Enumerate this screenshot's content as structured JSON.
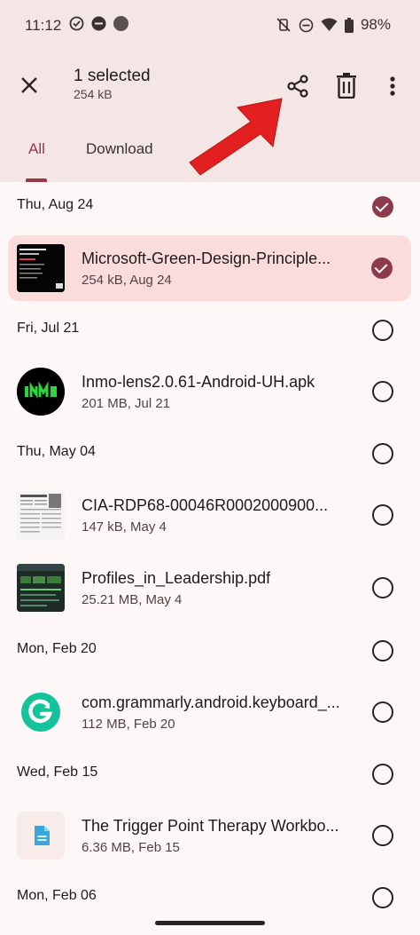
{
  "status": {
    "time": "11:12",
    "battery": "98%"
  },
  "appbar": {
    "title": "1 selected",
    "subtitle": "254 kB"
  },
  "tabs": [
    "All",
    "Download"
  ],
  "groups": [
    {
      "date": "Thu, Aug 24",
      "checked": true
    },
    {
      "date": "Fri, Jul 21",
      "checked": false
    },
    {
      "date": "Thu, May 04",
      "checked": false
    },
    {
      "date": "Mon, Feb 20",
      "checked": false
    },
    {
      "date": "Wed, Feb 15",
      "checked": false
    },
    {
      "date": "Mon, Feb 06",
      "checked": false
    }
  ],
  "files": [
    {
      "name": "Microsoft-Green-Design-Principle...",
      "meta": "254 kB, Aug 24",
      "selected": true,
      "icon": "document-thumbnail"
    },
    {
      "name": "Inmo-lens2.0.61-Android-UH.apk",
      "meta": "201 MB, Jul 21",
      "selected": false,
      "icon": "inmo-app-icon"
    },
    {
      "name": "CIA-RDP68-00046R0002000900...",
      "meta": "147 kB, May 4",
      "selected": false,
      "icon": "newspaper-thumbnail"
    },
    {
      "name": "Profiles_in_Leadership.pdf",
      "meta": "25.21 MB, May 4",
      "selected": false,
      "icon": "pdf-thumbnail"
    },
    {
      "name": "com.grammarly.android.keyboard_...",
      "meta": "112 MB, Feb 20",
      "selected": false,
      "icon": "grammarly-icon"
    },
    {
      "name": "The Trigger Point Therapy Workbo...",
      "meta": "6.36 MB, Feb 15",
      "selected": false,
      "icon": "file-icon"
    }
  ],
  "colors": {
    "accent": "#9a3648",
    "selected_row": "#fbdcdc",
    "header_bg": "#f3e6e4",
    "arrow": "#e32020"
  }
}
